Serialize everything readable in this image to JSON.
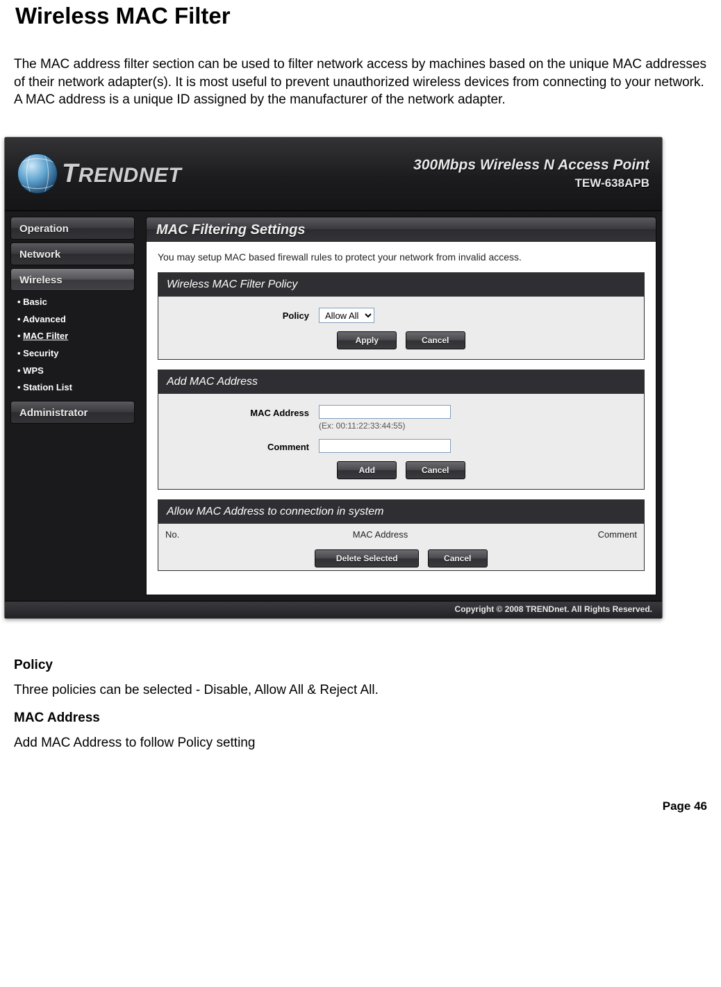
{
  "doc": {
    "heading": "Wireless MAC Filter",
    "intro": "The MAC address filter section can be used to filter network access by machines based on the unique MAC addresses of their network adapter(s). It is most useful to prevent unauthorized wireless devices from connecting to your network. A MAC address is a unique ID assigned by the manufacturer of the network adapter.",
    "policy_h": "Policy",
    "policy_t": "Three policies can be selected - Disable, Allow All & Reject All.",
    "mac_h": "MAC Address",
    "mac_t": "Add MAC Address to follow Policy setting",
    "page": "Page 46"
  },
  "brand": {
    "name": "TRENDNET",
    "product_l1": "300Mbps Wireless N Access Point",
    "product_l2": "TEW-638APB",
    "copyright": "Copyright © 2008 TRENDnet. All Rights Reserved."
  },
  "nav": {
    "operation": "Operation",
    "network": "Network",
    "wireless": "Wireless",
    "administrator": "Administrator",
    "items": [
      {
        "label": "Basic"
      },
      {
        "label": "Advanced"
      },
      {
        "label": "MAC Filter"
      },
      {
        "label": "Security"
      },
      {
        "label": "WPS"
      },
      {
        "label": "Station List"
      }
    ]
  },
  "content": {
    "title": "MAC Filtering Settings",
    "note": "You may setup MAC based firewall rules to protect your network from invalid access.",
    "p1": {
      "header": "Wireless MAC Filter Policy",
      "policy_label": "Policy",
      "policy_value": "Allow All",
      "apply": "Apply",
      "cancel": "Cancel"
    },
    "p2": {
      "header": "Add MAC Address",
      "mac_label": "MAC Address",
      "mac_hint": "(Ex: 00:11:22:33:44:55)",
      "comment_label": "Comment",
      "add": "Add",
      "cancel": "Cancel"
    },
    "p3": {
      "header": "Allow MAC Address to connection in system",
      "col_no": "No.",
      "col_mac": "MAC Address",
      "col_comment": "Comment",
      "delete": "Delete Selected",
      "cancel": "Cancel"
    }
  }
}
